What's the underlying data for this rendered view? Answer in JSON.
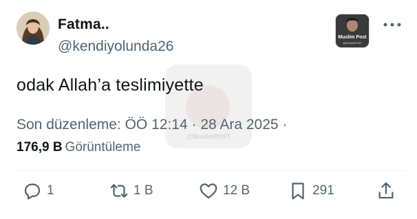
{
  "author": {
    "display_name": "Fatma..",
    "handle": "@kendiyolunda26"
  },
  "channel_badge": {
    "title": "Muslim Post",
    "subtitle": "@MuslimPOST"
  },
  "tweet": {
    "text": "odak Allah’a teslimiyette",
    "meta": "Son düzenleme: ÖÖ 12:14 · 28 Ara 2025 ·",
    "views_count": "176,9 B",
    "views_label": "Görüntüleme"
  },
  "watermark": {
    "text": "@MuslimPOST"
  },
  "actions": {
    "reply_count": "1",
    "retweet_count": "1 B",
    "like_count": "12 B",
    "bookmark_count": "291"
  },
  "icons": {
    "reply": "reply-icon",
    "retweet": "retweet-icon",
    "like": "heart-icon",
    "bookmark": "bookmark-icon",
    "share": "share-icon",
    "more": "more-options-icon"
  },
  "colors": {
    "text_primary": "#0f1419",
    "text_secondary": "#536471",
    "divider": "#eff3f4"
  }
}
